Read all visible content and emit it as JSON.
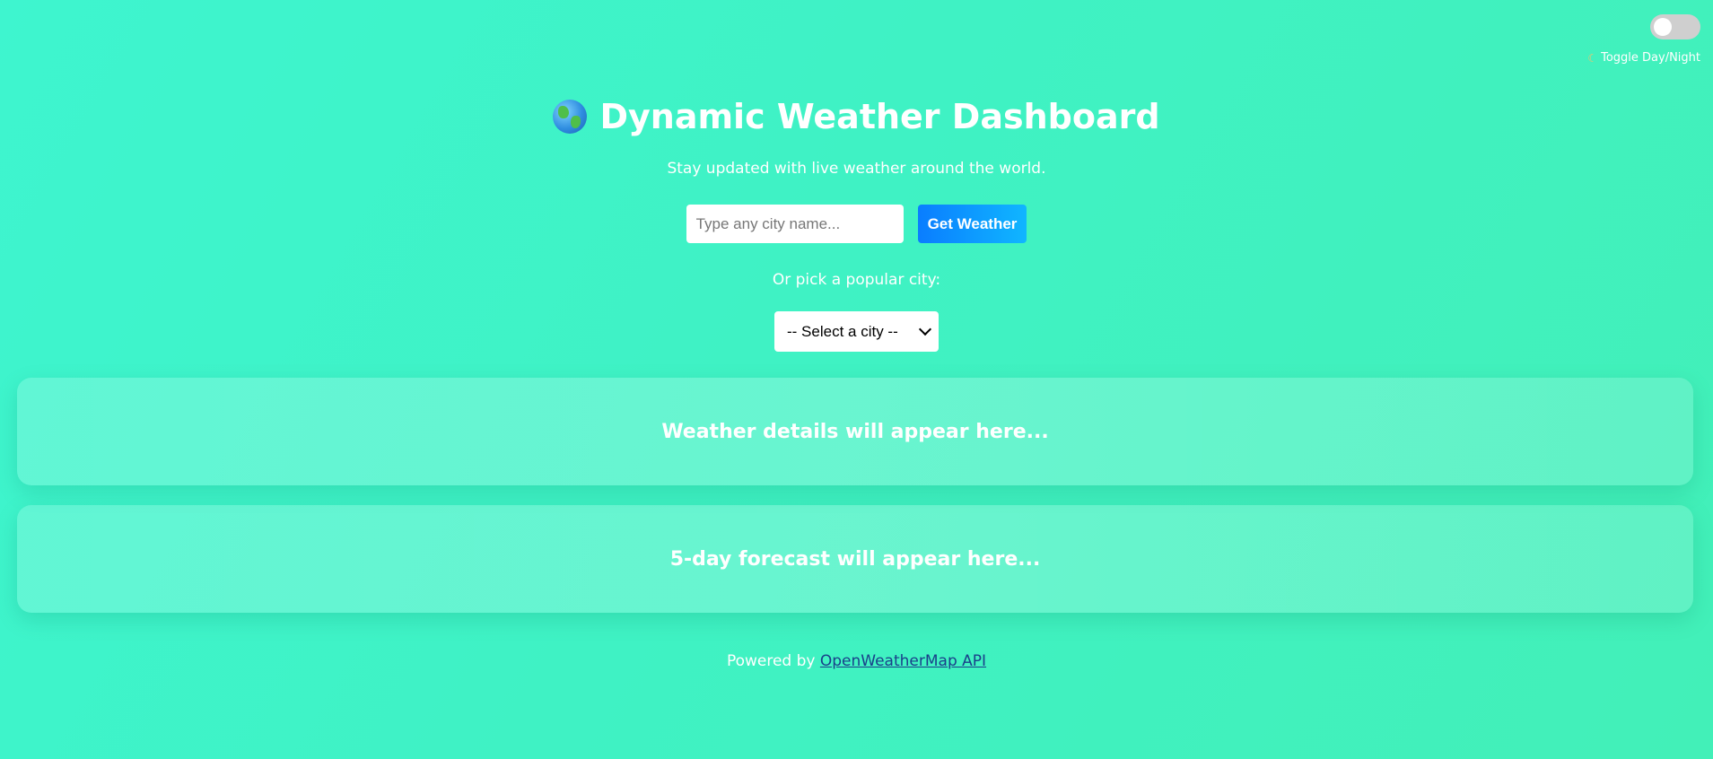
{
  "theme_toggle": {
    "label": "Toggle Day/Night",
    "icon": "moon-icon",
    "state": "off"
  },
  "header": {
    "icon": "globe-icon",
    "title": "Dynamic Weather Dashboard",
    "subtitle": "Stay updated with live weather around the world."
  },
  "search": {
    "placeholder": "Type any city name...",
    "value": "",
    "button_label": "Get Weather"
  },
  "popular": {
    "label": "Or pick a popular city:",
    "selected": "-- Select a city --"
  },
  "weather_card": {
    "placeholder": "Weather details will appear here..."
  },
  "forecast_card": {
    "placeholder": "5-day forecast will appear here..."
  },
  "footer": {
    "prefix": "Powered by",
    "link_text": "OpenWeatherMap API"
  },
  "colors": {
    "background": "#3ef3c8",
    "button_start": "#0a7dff",
    "button_end": "#10b6ff",
    "link": "#1a3f8a"
  }
}
